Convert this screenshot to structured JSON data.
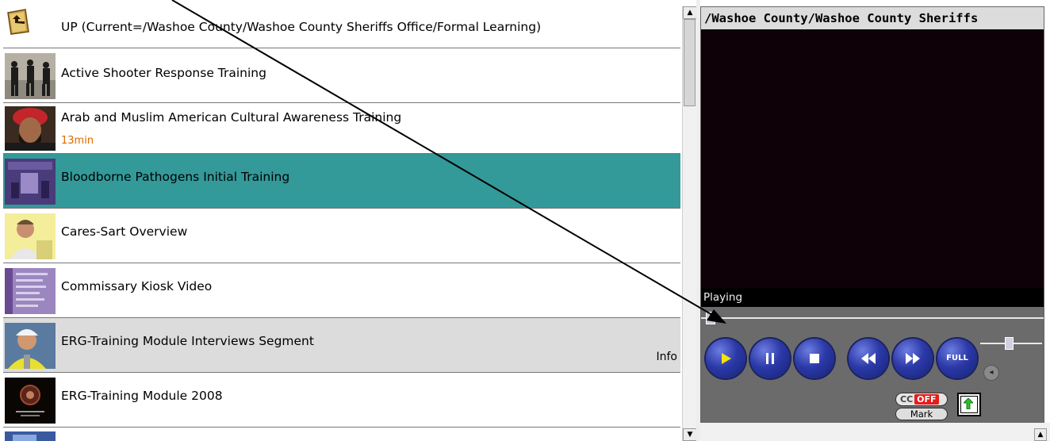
{
  "list": {
    "rows": [
      {
        "title": "UP (Current=/Washoe County/Washoe County Sheriffs Office/Formal Learning)",
        "duration": "",
        "info": ""
      },
      {
        "title": "Active Shooter Response Training",
        "duration": "",
        "info": ""
      },
      {
        "title": "Arab and Muslim American Cultural Awareness Training",
        "duration": "13min",
        "info": ""
      },
      {
        "title": "Bloodborne Pathogens Initial Training",
        "duration": "",
        "info": ""
      },
      {
        "title": "Cares-Sart Overview",
        "duration": "",
        "info": ""
      },
      {
        "title": "Commissary Kiosk Video",
        "duration": "",
        "info": ""
      },
      {
        "title": "ERG-Training Module Interviews Segment",
        "duration": "",
        "info": "Info"
      },
      {
        "title": "ERG-Training Module 2008",
        "duration": "",
        "info": ""
      }
    ]
  },
  "player": {
    "title": "/Washoe County/Washoe County Sheriffs",
    "status": "Playing",
    "buttons": {
      "play": "play-icon",
      "pause": "pause-icon",
      "stop": "stop-icon",
      "rewind": "rewind-icon",
      "forward": "fast-forward-icon",
      "full": "FULL"
    },
    "cc_label": "CC",
    "cc_state": "OFF",
    "mark_label": "Mark",
    "seek_progress": 0.01,
    "volume_level": 0.43
  },
  "colors": {
    "selected_row": "#339999",
    "hover_row": "#dcdcdc",
    "duration_text": "#e06a00",
    "player_bg": "#6b6b6b",
    "button_blue": "#2c39a8"
  }
}
